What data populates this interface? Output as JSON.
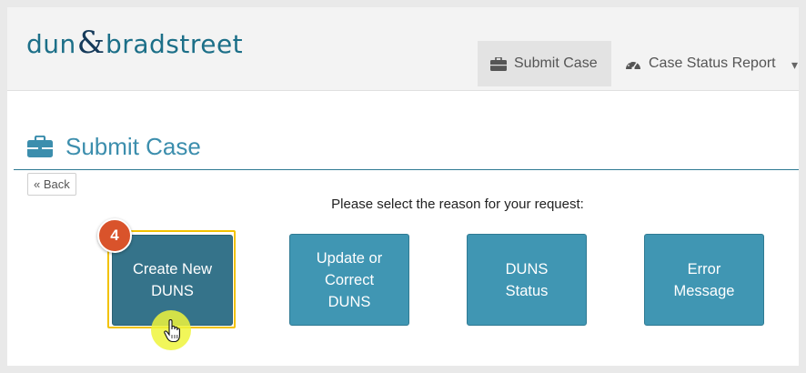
{
  "logo": {
    "part1": "dun",
    "amp": "&",
    "part2": "bradstreet"
  },
  "nav": {
    "tabs": [
      {
        "label": "Submit Case",
        "icon": "briefcase-icon",
        "active": true
      },
      {
        "label": "Case Status Report",
        "icon": "dashboard-icon",
        "active": false
      }
    ]
  },
  "page": {
    "title": "Submit Case",
    "title_icon": "briefcase-icon"
  },
  "back_label": "« Back",
  "prompt": "Please select the reason for your request:",
  "reasons": [
    {
      "lines": [
        "Create New",
        "DUNS"
      ],
      "selected": true
    },
    {
      "lines": [
        "Update or",
        "Correct",
        "DUNS"
      ],
      "selected": false
    },
    {
      "lines": [
        "DUNS Status"
      ],
      "selected": false
    },
    {
      "lines": [
        "Error",
        "Message"
      ],
      "selected": false
    }
  ],
  "step_badge": "4",
  "colors": {
    "brand_teal": "#1c6f88",
    "button": "#4096b3",
    "button_selected": "#35738a",
    "highlight": "#f2c200",
    "badge": "#d9532b"
  }
}
